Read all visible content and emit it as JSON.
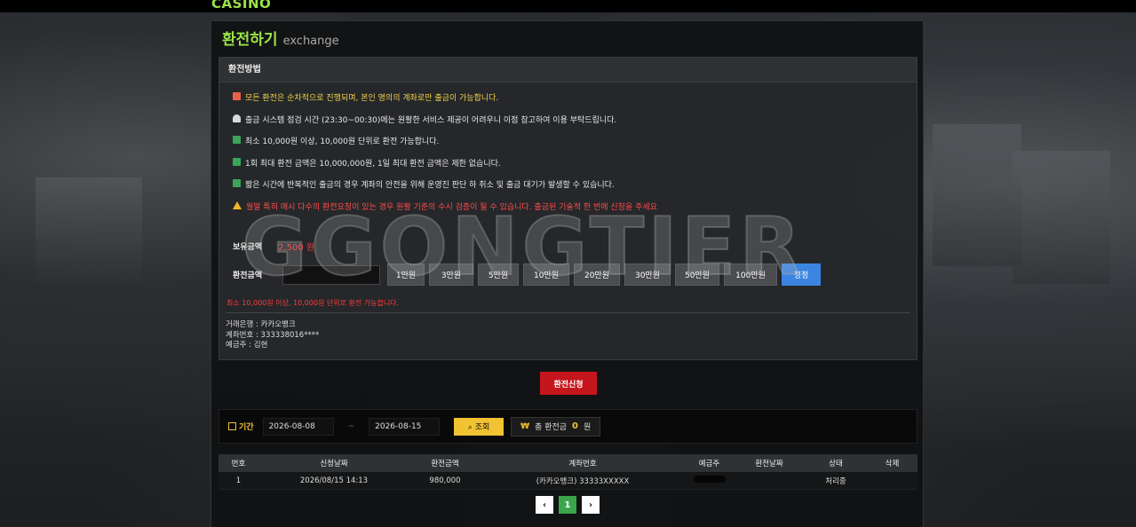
{
  "brand": {
    "logo": "CASINO"
  },
  "header": {
    "title_ko": "환전하기",
    "title_en": "exchange"
  },
  "guide": {
    "heading": "환전방법",
    "notes": [
      {
        "icon": "megaphone-icon",
        "text": "모든 환전은 순차적으로 진행되며, 본인 명의의 계좌로만 출금이 가능합니다."
      },
      {
        "icon": "siren-icon",
        "text": "출금 시스템 점검 시간 (23:30~00:30)에는 원활한 서비스 제공이 어려우니 이점 참고하여 이용 부탁드립니다."
      },
      {
        "icon": "check-icon",
        "text": "최소 10,000원 이상, 10,000원 단위로 환전 가능합니다."
      },
      {
        "icon": "check-icon",
        "text": "1회 최대 환전 금액은 10,000,000원, 1일 최대 환전 금액은 제한 없습니다."
      },
      {
        "icon": "check-icon",
        "text": "짧은 시간에 반복적인 출금의 경우 계좌의 안전을 위해 운영진 판단 하 취소 및 출금 대기가 발생할 수 있습니다."
      },
      {
        "icon": "warning-icon",
        "text": "월말 특히 매시 다수의 환전요청이 있는 경우 원활 기준의 수시 검증이 될 수 있습니다. 출금된 기술적 한 번에 신청을 주세요"
      }
    ]
  },
  "watermark": "GGONGTIER",
  "balance": {
    "label": "보유금액",
    "value": "2,500 원"
  },
  "amount": {
    "label": "환전금액",
    "value": "",
    "buttons": [
      "1만원",
      "3만원",
      "5만원",
      "10만원",
      "20만원",
      "30만원",
      "50만원",
      "100만원"
    ],
    "reset": "정정",
    "hint": "최소 10,000원 이상, 10,000원 단위로 환전 가능합니다."
  },
  "bank": {
    "bank_line": "거래은행 : 카카오뱅크",
    "account_line": "계좌번호 : 333338016****",
    "holder_line": "예금주 : 김현"
  },
  "submit_label": "환전신청",
  "filter": {
    "period_label": "기간",
    "start_date": "2026-08-08",
    "end_date": "2026-08-15",
    "separator": "~",
    "search_label": "조회",
    "total_label": "총 환전금",
    "total_value": "0",
    "total_unit": "원"
  },
  "table": {
    "headers": [
      "번호",
      "신청날짜",
      "환전금액",
      "계좌번호",
      "예금주",
      "환전날짜",
      "상태",
      "삭제"
    ],
    "rows": [
      {
        "no": "1",
        "date": "2026/08/15 14:13",
        "amount": "980,000",
        "account": "(카카오뱅크) 33333XXXXX",
        "holder": "",
        "done_date": "",
        "status": "처리중",
        "delete": ""
      }
    ]
  },
  "pager": {
    "prev": "‹",
    "current": "1",
    "next": "›"
  }
}
